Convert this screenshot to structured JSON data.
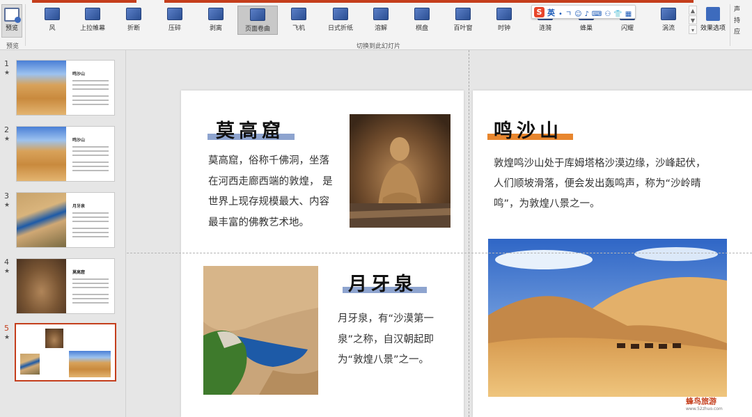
{
  "ribbon": {
    "preview_label": "预览",
    "preview_group_label": "预览",
    "transitions_group_label": "切换到此幻灯片",
    "effects": [
      {
        "label": "风",
        "icon": "wind-icon"
      },
      {
        "label": "上拉帷幕",
        "icon": "curtain-icon"
      },
      {
        "label": "折断",
        "icon": "fracture-icon"
      },
      {
        "label": "压碎",
        "icon": "crush-icon"
      },
      {
        "label": "剥离",
        "icon": "peel-icon"
      },
      {
        "label": "页面卷曲",
        "icon": "page-curl-icon",
        "selected": true
      },
      {
        "label": "飞机",
        "icon": "airplane-icon"
      },
      {
        "label": "日式折纸",
        "icon": "origami-icon"
      },
      {
        "label": "溶解",
        "icon": "dissolve-icon"
      },
      {
        "label": "棋盘",
        "icon": "checkerboard-icon"
      },
      {
        "label": "百叶窗",
        "icon": "blinds-icon"
      },
      {
        "label": "时钟",
        "icon": "clock-icon"
      },
      {
        "label": "涟漪",
        "icon": "ripple-icon"
      },
      {
        "label": "蜂巢",
        "icon": "honeycomb-icon"
      },
      {
        "label": "闪耀",
        "icon": "glitter-icon"
      },
      {
        "label": "涡流",
        "icon": "vortex-icon"
      }
    ],
    "effect_options_label": "效果选项",
    "right_items": [
      "声",
      "持",
      "应"
    ],
    "accent_color": "#c43e1c"
  },
  "ime": {
    "logo": "S",
    "lang": "英",
    "tools": "•ㄱ☺♪⌨⚇👕▦"
  },
  "thumbnails": [
    {
      "num": "1",
      "star": "★",
      "title": "鸣沙山",
      "kind": "desert"
    },
    {
      "num": "2",
      "star": "★",
      "title": "鸣沙山",
      "kind": "desert"
    },
    {
      "num": "3",
      "star": "★",
      "title": "月牙泉",
      "kind": "pond"
    },
    {
      "num": "4",
      "star": "★",
      "title": "莫高窟",
      "kind": "cave"
    },
    {
      "num": "5",
      "star": "★",
      "title": "",
      "kind": "combo",
      "active": true
    }
  ],
  "slide_left": {
    "mogao_title": "莫高窟",
    "mogao_text": [
      "莫高窟，俗称千佛洞，坐落",
      "在河西走廊西端的敦煌， 是",
      "世界上现存规模最大、内容",
      "最丰富的佛教艺术地。"
    ],
    "yueya_title": "月牙泉",
    "yueya_text": [
      "月牙泉，有“沙漠第一",
      "泉”之称，自汉朝起即",
      "为“敦煌八景”之一。"
    ],
    "highlight_color": "#8ea4cf"
  },
  "slide_right": {
    "title": "鸣沙山",
    "text": [
      "敦煌鸣沙山处于库姆塔格沙漠边缘，沙峰起伏，",
      "人们顺坡滑落，便会发出轰鸣声，称为“沙岭晴",
      "鸣”，为敦煌八景之一。"
    ],
    "highlight_color": "#e8862e"
  },
  "watermark": {
    "main": "蜂鸟旅游",
    "sub": "www.52zhuo.com"
  }
}
